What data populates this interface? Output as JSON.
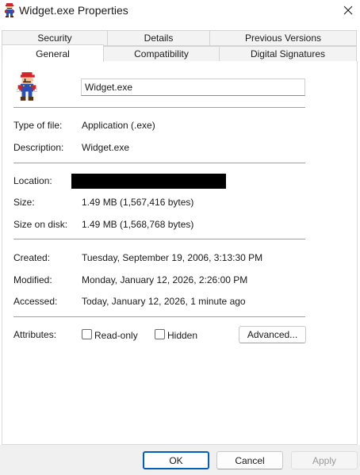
{
  "window": {
    "title": "Widget.exe Properties",
    "icon": "mario-app-icon",
    "close_glyph": "✕"
  },
  "tabs": {
    "row1": [
      {
        "label": "Security"
      },
      {
        "label": "Details"
      },
      {
        "label": "Previous Versions"
      }
    ],
    "row2": [
      {
        "label": "General",
        "active": true
      },
      {
        "label": "Compatibility"
      },
      {
        "label": "Digital Signatures"
      }
    ]
  },
  "general": {
    "filename": "Widget.exe",
    "type_label": "Type of file:",
    "type_value": "Application (.exe)",
    "description_label": "Description:",
    "description_value": "Widget.exe",
    "location_label": "Location:",
    "size_label": "Size:",
    "size_value": "1.49 MB (1,567,416 bytes)",
    "size_on_disk_label": "Size on disk:",
    "size_on_disk_value": "1.49 MB (1,568,768 bytes)",
    "created_label": "Created:",
    "created_value": "Tuesday, September 19, 2006, 3:13:30 PM",
    "modified_label": "Modified:",
    "modified_value": "Monday, January 12, 2026, 2:26:00 PM",
    "accessed_label": "Accessed:",
    "accessed_value": "Today, January 12, 2026, 1 minute ago",
    "attributes_label": "Attributes:",
    "readonly_label": "Read-only",
    "readonly_checked": false,
    "hidden_label": "Hidden",
    "hidden_checked": false,
    "advanced_label": "Advanced..."
  },
  "footer": {
    "ok_label": "OK",
    "cancel_label": "Cancel",
    "apply_label": "Apply"
  },
  "colors": {
    "accent": "#005fb8",
    "redaction": "#000000"
  }
}
